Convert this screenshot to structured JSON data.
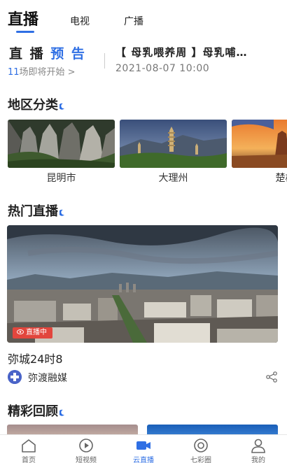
{
  "tabs": [
    {
      "label": "直播",
      "active": true
    },
    {
      "label": "电视",
      "active": false
    },
    {
      "label": "广播",
      "active": false
    }
  ],
  "live_preview": {
    "title_a": "直 播 ",
    "title_b": "预 告",
    "count_num": "11",
    "count_text": "场即将开始 >",
    "program_title": "【 母乳喂养周 】母乳哺…",
    "program_time": "2021-08-07 10:00"
  },
  "regions": {
    "heading": "地区分类",
    "items": [
      {
        "label": "昆明市"
      },
      {
        "label": "大理州"
      },
      {
        "label": "楚雄"
      }
    ]
  },
  "hot_live": {
    "heading": "热门直播",
    "badge": "直播中",
    "title": "弥城24时8",
    "source": "弥渡融媒",
    "share_icon": "share-icon"
  },
  "review": {
    "heading": "精彩回顾"
  },
  "bottom_nav": [
    {
      "label": "首页",
      "icon": "home-icon",
      "active": false
    },
    {
      "label": "短视频",
      "icon": "play-icon",
      "active": false
    },
    {
      "label": "云直播",
      "icon": "camera-icon",
      "active": true
    },
    {
      "label": "七彩圈",
      "icon": "circle-icon",
      "active": false
    },
    {
      "label": "我的",
      "icon": "user-icon",
      "active": false
    }
  ],
  "colors": {
    "accent": "#2f6fe4",
    "live_badge": "#e2463d"
  }
}
